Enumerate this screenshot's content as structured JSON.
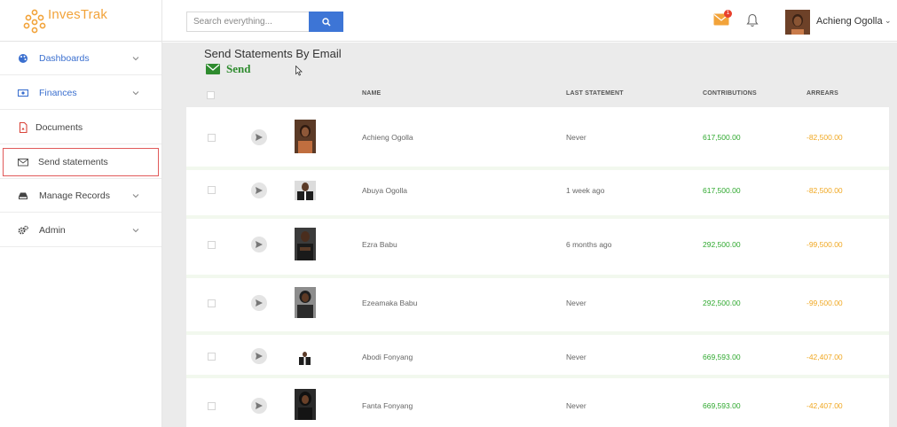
{
  "app": {
    "name": "InvesTrak"
  },
  "search": {
    "placeholder": "Search everything..."
  },
  "header": {
    "mail_badge": "1",
    "user_name": "Achieng Ogolla"
  },
  "sidebar": {
    "items": [
      {
        "label": "Dashboards",
        "icon": "palette-icon",
        "expandable": true
      },
      {
        "label": "Finances",
        "icon": "money-icon",
        "expandable": true
      },
      {
        "label": "Documents",
        "icon": "pdf-icon",
        "expandable": false
      },
      {
        "label": "Send statements",
        "icon": "envelope-icon",
        "expandable": false,
        "selected": true
      },
      {
        "label": "Manage Records",
        "icon": "drive-icon",
        "expandable": true
      },
      {
        "label": "Admin",
        "icon": "cogs-icon",
        "expandable": true
      }
    ]
  },
  "main": {
    "title": "Send Statements By Email",
    "send_label": "Send",
    "columns": [
      "NAME",
      "LAST STATEMENT",
      "CONTRIBUTIONS",
      "ARREARS"
    ],
    "rows": [
      {
        "name": "Achieng Ogolla",
        "last_statement": "Never",
        "contributions": "617,500.00",
        "arrears": "-82,500.00"
      },
      {
        "name": "Abuya Ogolla",
        "last_statement": "1 week ago",
        "contributions": "617,500.00",
        "arrears": "-82,500.00"
      },
      {
        "name": "Ezra Babu",
        "last_statement": "6 months ago",
        "contributions": "292,500.00",
        "arrears": "-99,500.00"
      },
      {
        "name": "Ezeamaka Babu",
        "last_statement": "Never",
        "contributions": "292,500.00",
        "arrears": "-99,500.00"
      },
      {
        "name": "Abodi Fonyang",
        "last_statement": "Never",
        "contributions": "669,593.00",
        "arrears": "-42,407.00"
      },
      {
        "name": "Fanta Fonyang",
        "last_statement": "Never",
        "contributions": "669,593.00",
        "arrears": "-42,407.00"
      }
    ]
  },
  "colors": {
    "accent_blue": "#3d75d6",
    "send_green": "#2e8b2e",
    "positive": "#2ea82e",
    "arrears": "#f0a720",
    "logo": "#f2a33a",
    "selection_outline": "#e15a5a"
  }
}
